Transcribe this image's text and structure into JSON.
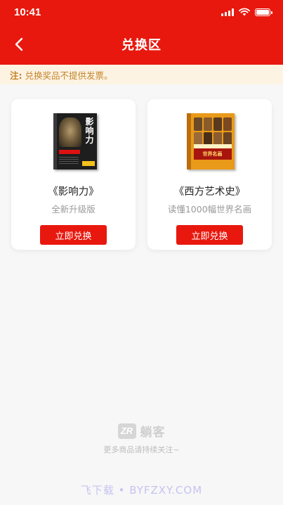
{
  "status_bar": {
    "time": "10:41",
    "icons": [
      "signal-icon",
      "wifi-icon",
      "battery-icon"
    ]
  },
  "nav": {
    "title": "兑换区",
    "back_icon": "chevron-left-icon"
  },
  "notice": {
    "label": "注:",
    "text": "兑换奖品不提供发票。"
  },
  "products": [
    {
      "name": "《影响力》",
      "subtitle": "全新升级版",
      "button_label": "立即兑换",
      "cover_text": "影响力"
    },
    {
      "name": "《西方艺术史》",
      "subtitle": "读懂1000幅世界名画",
      "button_label": "立即兑换",
      "cover_text": "世界名画"
    }
  ],
  "footer": {
    "logo_mark": "ZR",
    "logo_text": "躺客",
    "tip": "更多商品请持续关注~"
  },
  "watermark": "飞下载 • BYFZXY.COM",
  "colors": {
    "brand_red": "#e8180e",
    "notice_bg": "#fdf3e3",
    "notice_text": "#c2852a"
  }
}
